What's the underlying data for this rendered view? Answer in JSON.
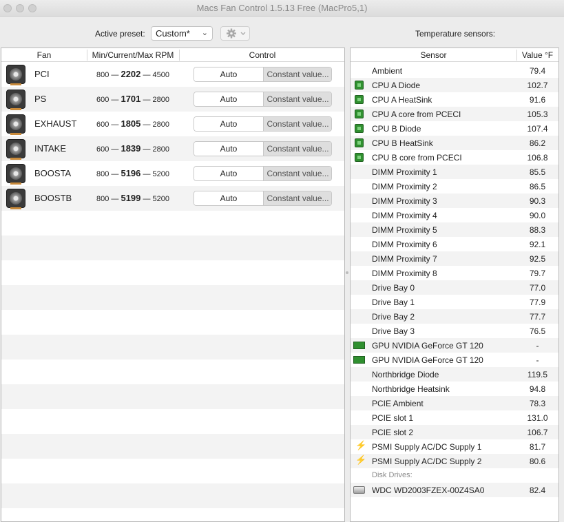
{
  "window": {
    "title": "Macs Fan Control 1.5.13 Free (MacPro5,1)"
  },
  "toolbar": {
    "preset_label": "Active preset:",
    "preset_value": "Custom*",
    "sensors_label": "Temperature sensors:"
  },
  "fan_table": {
    "headers": {
      "fan": "Fan",
      "rpm": "Min/Current/Max RPM",
      "control": "Control"
    },
    "rows": [
      {
        "name": "PCI",
        "min": "800",
        "current": "2202",
        "max": "4500",
        "auto": "Auto",
        "constant": "Constant value..."
      },
      {
        "name": "PS",
        "min": "600",
        "current": "1701",
        "max": "2800",
        "auto": "Auto",
        "constant": "Constant value..."
      },
      {
        "name": "EXHAUST",
        "min": "600",
        "current": "1805",
        "max": "2800",
        "auto": "Auto",
        "constant": "Constant value..."
      },
      {
        "name": "INTAKE",
        "min": "600",
        "current": "1839",
        "max": "2800",
        "auto": "Auto",
        "constant": "Constant value..."
      },
      {
        "name": "BOOSTA",
        "min": "800",
        "current": "5196",
        "max": "5200",
        "auto": "Auto",
        "constant": "Constant value..."
      },
      {
        "name": "BOOSTB",
        "min": "800",
        "current": "5199",
        "max": "5200",
        "auto": "Auto",
        "constant": "Constant value..."
      }
    ],
    "separator": "—"
  },
  "sensor_table": {
    "headers": {
      "sensor": "Sensor",
      "value": "Value °F"
    },
    "rows": [
      {
        "name": "Ambient",
        "value": "79.4",
        "icon": "none"
      },
      {
        "name": "CPU A Diode",
        "value": "102.7",
        "icon": "chip-icon"
      },
      {
        "name": "CPU A HeatSink",
        "value": "91.6",
        "icon": "chip-icon"
      },
      {
        "name": "CPU A core from PCECI",
        "value": "105.3",
        "icon": "chip-icon"
      },
      {
        "name": "CPU B Diode",
        "value": "107.4",
        "icon": "chip-icon"
      },
      {
        "name": "CPU B HeatSink",
        "value": "86.2",
        "icon": "chip-icon"
      },
      {
        "name": "CPU B core from PCECI",
        "value": "106.8",
        "icon": "chip-icon"
      },
      {
        "name": "DIMM Proximity 1",
        "value": "85.5",
        "icon": "none"
      },
      {
        "name": "DIMM Proximity 2",
        "value": "86.5",
        "icon": "none"
      },
      {
        "name": "DIMM Proximity 3",
        "value": "90.3",
        "icon": "none"
      },
      {
        "name": "DIMM Proximity 4",
        "value": "90.0",
        "icon": "none"
      },
      {
        "name": "DIMM Proximity 5",
        "value": "88.3",
        "icon": "none"
      },
      {
        "name": "DIMM Proximity 6",
        "value": "92.1",
        "icon": "none"
      },
      {
        "name": "DIMM Proximity 7",
        "value": "92.5",
        "icon": "none"
      },
      {
        "name": "DIMM Proximity 8",
        "value": "79.7",
        "icon": "none"
      },
      {
        "name": "Drive Bay 0",
        "value": "77.0",
        "icon": "none"
      },
      {
        "name": "Drive Bay 1",
        "value": "77.9",
        "icon": "none"
      },
      {
        "name": "Drive Bay 2",
        "value": "77.7",
        "icon": "none"
      },
      {
        "name": "Drive Bay 3",
        "value": "76.5",
        "icon": "none"
      },
      {
        "name": "GPU NVIDIA GeForce GT 120",
        "value": "-",
        "icon": "gpu-icon"
      },
      {
        "name": "GPU NVIDIA GeForce GT 120",
        "value": "-",
        "icon": "gpu-icon"
      },
      {
        "name": "Northbridge Diode",
        "value": "119.5",
        "icon": "none"
      },
      {
        "name": "Northbridge Heatsink",
        "value": "94.8",
        "icon": "none"
      },
      {
        "name": "PCIE Ambient",
        "value": "78.3",
        "icon": "none"
      },
      {
        "name": "PCIE slot 1",
        "value": "131.0",
        "icon": "none"
      },
      {
        "name": "PCIE slot 2",
        "value": "106.7",
        "icon": "none"
      },
      {
        "name": "PSMI Supply AC/DC Supply 1",
        "value": "81.7",
        "icon": "bolt-icon"
      },
      {
        "name": "PSMI Supply AC/DC Supply 2",
        "value": "80.6",
        "icon": "bolt-icon"
      }
    ],
    "disk_group_label": "Disk Drives:",
    "disk_rows": [
      {
        "name": "WDC WD2003FZEX-00Z4SA0",
        "value": "82.4",
        "icon": "disk-icon"
      }
    ]
  }
}
